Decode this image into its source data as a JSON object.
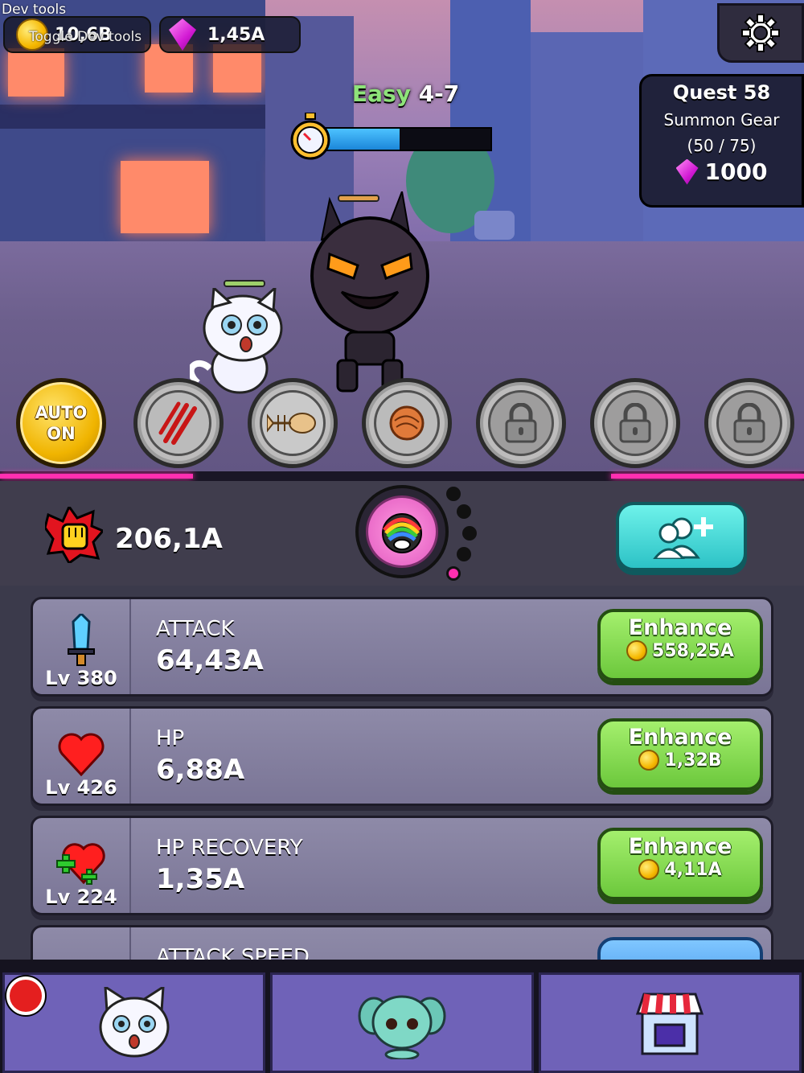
{
  "devtools": {
    "label": "Dev tools",
    "toggle": "Toggle Dev tools"
  },
  "resources": {
    "gold": "10,6B",
    "gems": "1,45A"
  },
  "stage": {
    "difficulty": "Easy",
    "level": "4-7",
    "timer_progress": 0.45
  },
  "quest": {
    "title": "Quest 58",
    "task": "Summon Gear",
    "progress": "(50 / 75)",
    "reward": "1000"
  },
  "skills": {
    "auto": {
      "line1": "AUTO",
      "line2": "ON"
    },
    "slots": [
      {
        "icon": "claw-slash-icon",
        "locked": false
      },
      {
        "icon": "fish-bone-icon",
        "locked": false
      },
      {
        "icon": "hairball-icon",
        "locked": false
      },
      {
        "icon": "lock-icon",
        "locked": true
      },
      {
        "icon": "lock-icon",
        "locked": true
      },
      {
        "icon": "lock-icon",
        "locked": true
      }
    ]
  },
  "power": {
    "value": "206,1A"
  },
  "upgrades": [
    {
      "level": "Lv 380",
      "name": "ATTACK",
      "value": "64,43A",
      "button": "Enhance",
      "cost": "558,25A",
      "icon": "sword-icon"
    },
    {
      "level": "Lv 426",
      "name": "HP",
      "value": "6,88A",
      "button": "Enhance",
      "cost": "1,32B",
      "icon": "heart-icon"
    },
    {
      "level": "Lv 224",
      "name": "HP RECOVERY",
      "value": "1,35A",
      "button": "Enhance",
      "cost": "4,11A",
      "icon": "heart-plus-icon"
    },
    {
      "level": "",
      "name": "ATTACK SPEED",
      "value": "",
      "button": "",
      "cost": "",
      "icon": "speed-icon"
    }
  ],
  "nav": [
    {
      "icon": "cat-icon"
    },
    {
      "icon": "pet-icon"
    },
    {
      "icon": "shop-icon"
    }
  ],
  "colors": {
    "accent_pink": "#ff2fb0",
    "enhance_green": "#7fd84a",
    "friend_teal": "#3fd6d8",
    "nav_purple": "#6f62b8"
  }
}
